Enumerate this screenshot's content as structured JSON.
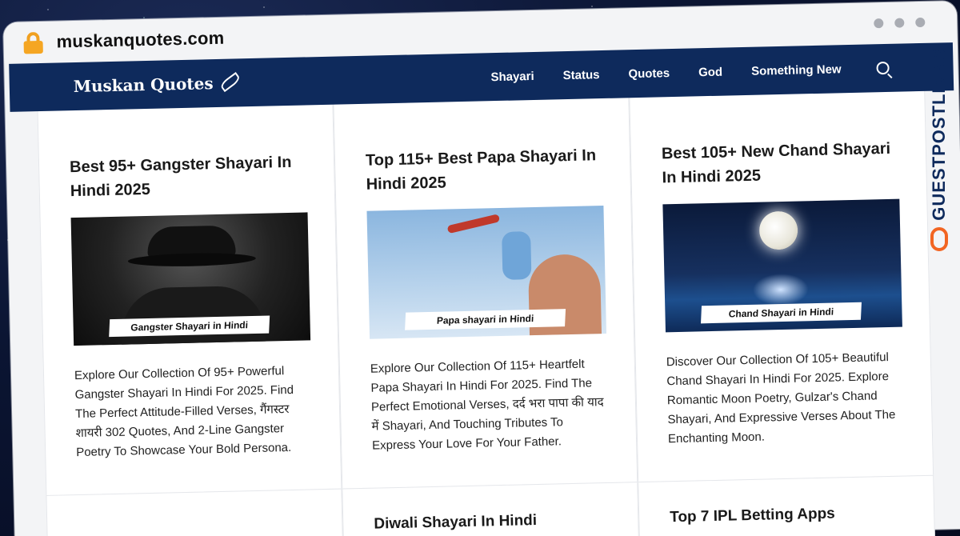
{
  "browser": {
    "url": "muskanquotes.com"
  },
  "site": {
    "logo": "Muskan Quotes",
    "nav": [
      "Shayari",
      "Status",
      "Quotes",
      "God",
      "Something New"
    ]
  },
  "posts": [
    {
      "title": "Best 95+ Gangster Shayari In Hindi 2025",
      "image_caption": "Gangster Shayari in Hindi",
      "excerpt": "Explore Our Collection Of 95+ Powerful Gangster Shayari In Hindi For 2025. Find The Perfect Attitude-Filled Verses, गैंगस्टर शायरी 302 Quotes, And 2-Line Gangster Poetry To Showcase Your Bold Persona."
    },
    {
      "title": "Top 115+ Best Papa Shayari In Hindi 2025",
      "image_caption": "Papa shayari in Hindi",
      "excerpt": "Explore Our Collection Of 115+ Heartfelt Papa Shayari In Hindi For 2025. Find The Perfect Emotional Verses, दर्द भरा पापा की याद में Shayari, And Touching Tributes To Express Your Love For Your Father."
    },
    {
      "title": "Best 105+ New Chand Shayari In Hindi 2025",
      "image_caption": "Chand Shayari in Hindi",
      "excerpt": "Discover Our Collection Of 105+ Beautiful Chand Shayari In Hindi For 2025. Explore Romantic Moon Poetry, Gulzar's Chand Shayari, And Expressive Verses About The Enchanting Moon."
    }
  ],
  "next_posts": [
    "",
    "Diwali Shayari In Hindi",
    "Top 7 IPL Betting Apps"
  ],
  "watermark": "GUESTPOSTLINKS"
}
